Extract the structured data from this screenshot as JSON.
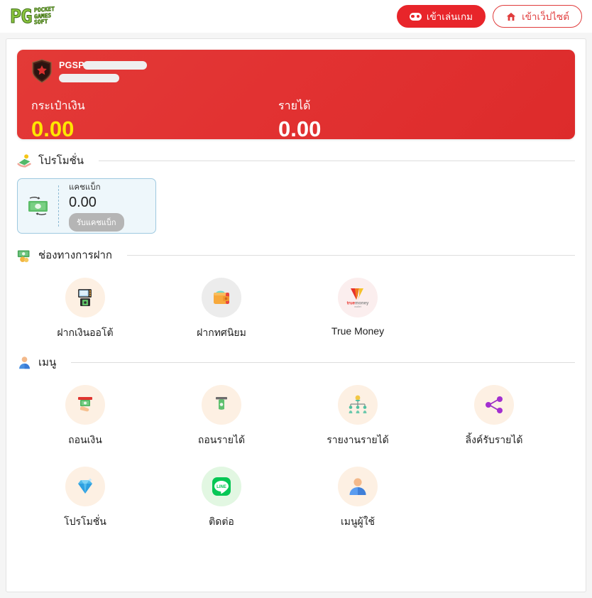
{
  "header": {
    "logo_pg": "PG",
    "logo_line1": "POCKET",
    "logo_line2": "GAMES",
    "logo_line3": "SOFT",
    "play_button": "เข้าเล่นเกม",
    "site_button": "เข้าเว็ปไซต์"
  },
  "balance_card": {
    "username": "PGSP",
    "wallet_label": "กระเป๋าเงิน",
    "wallet_value": "0.00",
    "income_label": "รายได้",
    "income_value": "0.00",
    "accent_red": "#e23232",
    "value_yellow": "#ffe600"
  },
  "promotion": {
    "section_title": "โปรโมชั่น",
    "cashback_label": "แคชแบ็ก",
    "cashback_value": "0.00",
    "claim_button": "รับแคชแบ็ก"
  },
  "deposit": {
    "section_title": "ช่องทางการฝาก",
    "items": [
      {
        "label": "ฝากเงินออโต้",
        "icon": "atm-machine-icon",
        "bg": "bg-cream"
      },
      {
        "label": "ฝากทศนิยม",
        "icon": "wallet-icon",
        "bg": "bg-gray"
      },
      {
        "label": "True Money",
        "icon": "truemoney-logo-icon",
        "bg": "bg-pink"
      }
    ]
  },
  "menu": {
    "section_title": "เมนู",
    "row1": [
      {
        "label": "ถอนเงิน",
        "icon": "withdraw-cash-icon",
        "bg": "bg-cream"
      },
      {
        "label": "ถอนรายได้",
        "icon": "withdraw-income-icon",
        "bg": "bg-cream"
      },
      {
        "label": "รายงานรายได้",
        "icon": "network-report-icon",
        "bg": "bg-cream"
      },
      {
        "label": "ลิ้งค์รับรายได้",
        "icon": "share-link-icon",
        "bg": "bg-cream"
      }
    ],
    "row2": [
      {
        "label": "โปรโมชั่น",
        "icon": "diamond-icon",
        "bg": "bg-cream"
      },
      {
        "label": "ติดต่อ",
        "icon": "line-chat-icon",
        "bg": "bg-green"
      },
      {
        "label": "เมนูผู้ใช้",
        "icon": "user-profile-icon",
        "bg": "bg-cream"
      }
    ]
  }
}
